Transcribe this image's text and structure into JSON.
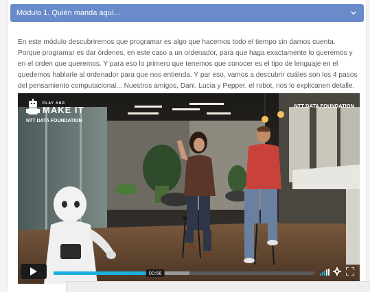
{
  "module": {
    "title": "Módulo 1. Quién manda aquí...",
    "chevron_icon": "chevron-down-icon"
  },
  "description": "En este módulo descubriremos que programar es algo que hacemos todo el tiempo sin darnos cuenta. Porque programar es dar órdenes, en este caso a un ordenador, para que haga exactamente lo queremos y en el orden que queremos. Y para eso lo primero que tenemos que conocer es el tipo de lenguaje en el quedemos hablarle al ordenador para que nos entienda. Y par eso, vamos a descubrir cuáles son los 4 pasos del pensamiento computacional... Nuestros amigos, Dani, Lucia y Pepper, el robot, nos lo explicanen detalle.",
  "video": {
    "brand_top": "PLAY AND",
    "brand_main": "MAKE IT",
    "brand_foundation": "NTT DATA FOUNDATION",
    "watermark": "NTT DATA FOUNDATION",
    "current_time": "00:56",
    "played_fraction": 0.39,
    "buffered_fraction": 0.52,
    "accent_color": "#1bb0e0"
  },
  "colors": {
    "header_bg": "#6a8bc9",
    "text": "#555a5f"
  }
}
